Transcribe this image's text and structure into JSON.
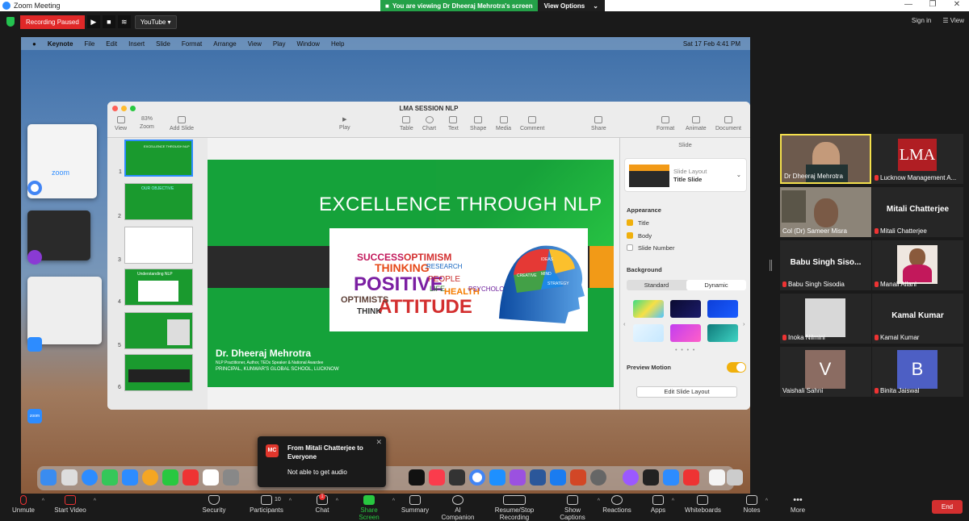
{
  "window": {
    "title": "Zoom Meeting",
    "minimize": "—",
    "maximize": "❐",
    "close": "✕"
  },
  "banner": {
    "message": "You are viewing Dr Dheeraj Mehrotra's screen",
    "view_options": "View Options"
  },
  "topbar": {
    "recording": "Recording Paused",
    "youtube": "YouTube",
    "sign_in": "Sign in",
    "view": "View"
  },
  "mac_menu": {
    "app": "Keynote",
    "items": [
      "File",
      "Edit",
      "Insert",
      "Slide",
      "Format",
      "Arrange",
      "View",
      "Play",
      "Window",
      "Help"
    ],
    "clock": "Sat 17 Feb  4:41 PM"
  },
  "mission": {
    "zoom_label": "zoom",
    "zoom_icon_label": "zoom"
  },
  "keynote": {
    "title": "LMA SESSION NLP",
    "zoom": "83%",
    "tools": [
      "View",
      "Zoom",
      "Add Slide",
      "Play",
      "Table",
      "Chart",
      "Text",
      "Shape",
      "Media",
      "Comment",
      "Share",
      "Format",
      "Animate",
      "Document"
    ],
    "thumb_titles": [
      "EXCELLENCE THROUGH NLP",
      "OUR OBJECTIVE",
      "",
      "Understanding NLP",
      "",
      ""
    ],
    "thumb_numbers": [
      "1",
      "2",
      "3",
      "4",
      "5",
      "6"
    ]
  },
  "slide": {
    "title": "EXCELLENCE THROUGH NLP",
    "author": "Dr. Dheeraj Mehrotra",
    "subtitle1": "NLP Practitioner, Author, TEDx Speaker & National Awardee",
    "subtitle2": "PRINCIPAL, KUNWAR'S GLOBAL SCHOOL, LUCKNOW",
    "words": [
      "SUCCESS",
      "OPTIMISM",
      "THINKING",
      "POSITIVE",
      "ATTITUDE",
      "OPTIMISTS",
      "THINK",
      "RESEARCH",
      "PEOPLE",
      "HEALTH",
      "PSYCHOLOGY",
      "LIFE",
      "CREATIVE",
      "IDEAS",
      "MIND",
      "STRATEGY"
    ]
  },
  "inspector": {
    "header": "Slide",
    "layout_label": "Slide Layout",
    "layout_value": "Title Slide",
    "appearance": "Appearance",
    "opt_title": "Title",
    "opt_body": "Body",
    "opt_slide_number": "Slide Number",
    "background": "Background",
    "standard": "Standard",
    "dynamic": "Dynamic",
    "preview_motion": "Preview Motion",
    "edit_layout": "Edit Slide Layout"
  },
  "toast": {
    "avatar": "MC",
    "title": "From Mitali Chatterjee to Everyone",
    "message": "Not able to get audio",
    "close": "✕"
  },
  "participants": [
    {
      "name": "Dr Dheeraj Mehrotra",
      "type": "video"
    },
    {
      "name": "Lucknow Management A...",
      "type": "logo",
      "logo": "LMA"
    },
    {
      "name": "Col (Dr) Sameer Misra",
      "type": "video"
    },
    {
      "name": "Mitali Chatterjee",
      "type": "text",
      "big": "Mitali Chatterjee"
    },
    {
      "name": "Babu Singh Sisodia",
      "type": "text",
      "big": "Babu Singh Siso..."
    },
    {
      "name": "Manali Ailani",
      "type": "photo"
    },
    {
      "name": "Inoka Nilmini",
      "type": "blank"
    },
    {
      "name": "Kamal Kumar",
      "type": "text",
      "big": "Kamal Kumar"
    },
    {
      "name": "Vaishali Sahni",
      "type": "letter",
      "letter": "V",
      "color": "#8b6c62"
    },
    {
      "name": "Binita Jaiswal",
      "type": "letter",
      "letter": "B",
      "color": "#4d5fc4"
    }
  ],
  "bottom": {
    "unmute": "Unmute",
    "start_video": "Start Video",
    "security": "Security",
    "participants": "Participants",
    "participants_count": "10",
    "chat": "Chat",
    "chat_badge": "1",
    "share": "Share Screen",
    "summary": "Summary",
    "ai": "AI Companion",
    "record": "Resume/Stop Recording",
    "captions": "Show Captions",
    "reactions": "Reactions",
    "apps": "Apps",
    "whiteboards": "Whiteboards",
    "notes": "Notes",
    "more": "More",
    "end": "End"
  }
}
